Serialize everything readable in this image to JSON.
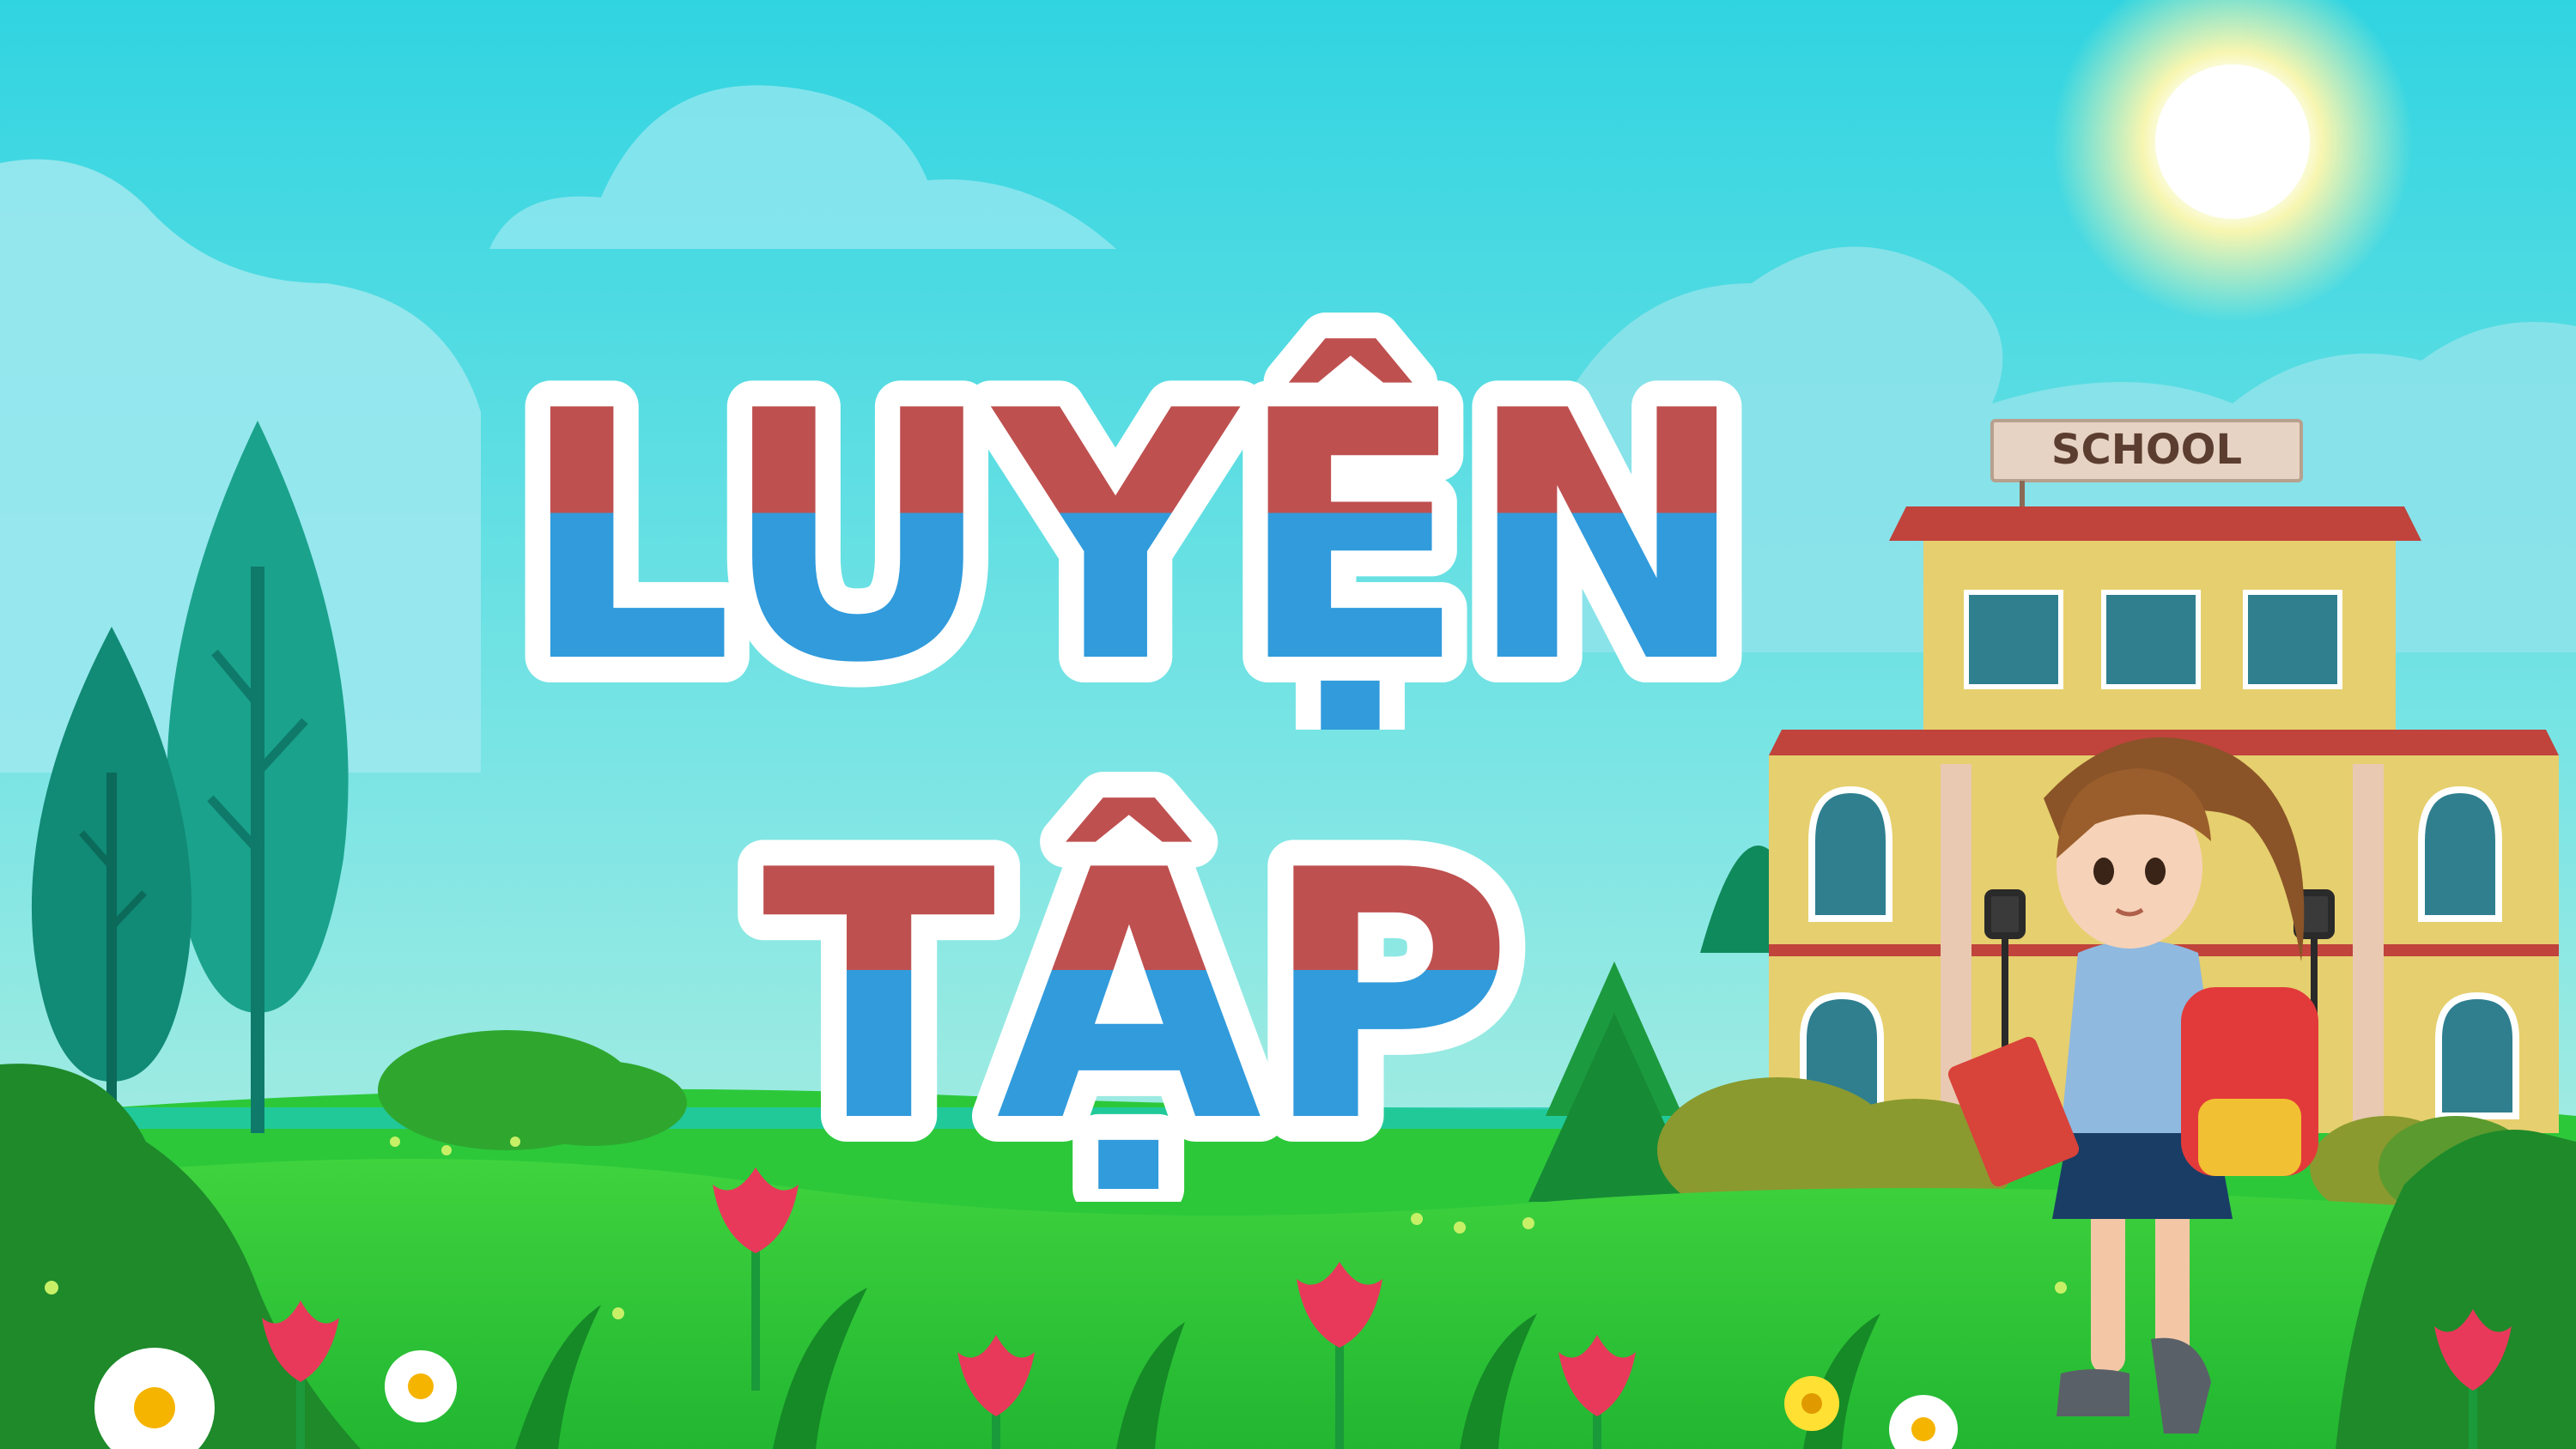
{
  "title": {
    "line1": "LUYỆN",
    "line2": "TẬP"
  },
  "school_sign": "SCHOOL",
  "colors": {
    "sky": "#34d6e2",
    "title_top": "#bf5050",
    "title_bottom": "#319bdc",
    "title_outline": "#ffffff",
    "grass": "#2cc83a",
    "tree": "#16a08a",
    "building_wall": "#e6cf6e",
    "roof": "#c0433c"
  },
  "icons": [
    "sun-icon",
    "cloud-icon",
    "tree-icon",
    "school-building-icon",
    "girl-student-icon",
    "flower-icon",
    "tulip-icon"
  ]
}
